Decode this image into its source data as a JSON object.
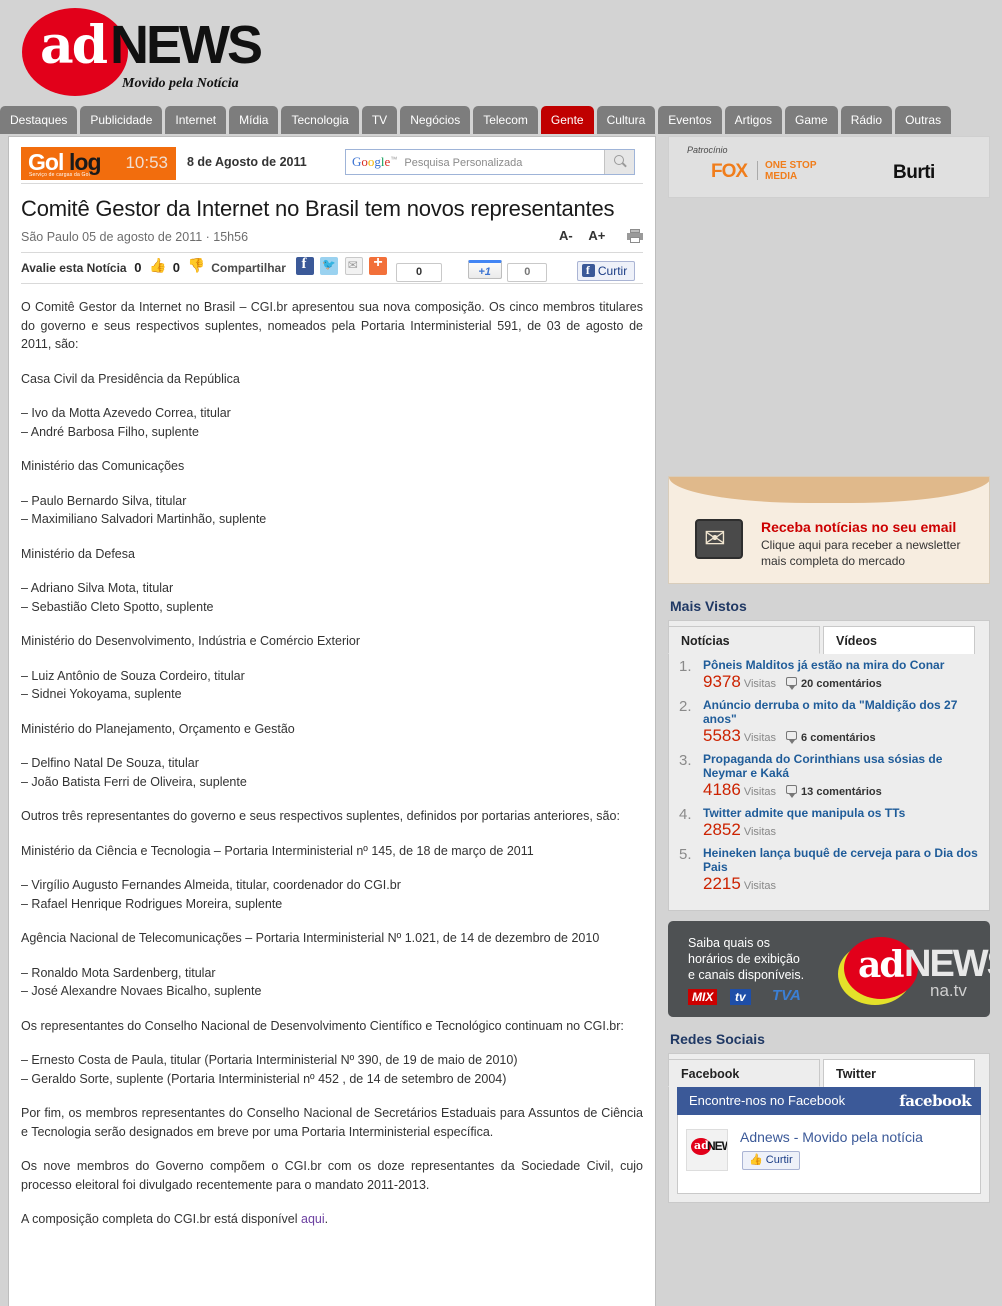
{
  "site": {
    "logo_ad": "ad",
    "logo_news": "NEWS",
    "tagline": "Movido pela Notícia"
  },
  "nav": {
    "items": [
      {
        "label": "Destaques",
        "active": false
      },
      {
        "label": "Publicidade",
        "active": false
      },
      {
        "label": "Internet",
        "active": false
      },
      {
        "label": "Mídia",
        "active": false
      },
      {
        "label": "Tecnologia",
        "active": false
      },
      {
        "label": "TV",
        "active": false
      },
      {
        "label": "Negócios",
        "active": false
      },
      {
        "label": "Telecom",
        "active": false
      },
      {
        "label": "Gente",
        "active": true
      },
      {
        "label": "Cultura",
        "active": false
      },
      {
        "label": "Eventos",
        "active": false
      },
      {
        "label": "Artigos",
        "active": false
      },
      {
        "label": "Game",
        "active": false
      },
      {
        "label": "Rádio",
        "active": false
      },
      {
        "label": "Outras",
        "active": false
      }
    ]
  },
  "topbar": {
    "gollog_go": "Gol",
    "gollog_log": "log",
    "gollog_sub": "Serviço de cargas da Gol",
    "time": "10:53",
    "date": "8 de Agosto de 2011",
    "search_brand": "Google",
    "search_tm": "™",
    "search_placeholder": "Pesquisa Personalizada"
  },
  "article": {
    "title": "Comitê Gestor da Internet no Brasil tem novos representantes",
    "byline": "São Paulo 05 de agosto de 2011 · 15h56",
    "font_decrease": "A-",
    "font_increase": "A+",
    "rate_label": "Avalie esta Notícia",
    "rate_up": "0",
    "rate_down": "0",
    "share_label": "Compartilhar",
    "share_count": "0",
    "plusone_label": "+1",
    "plusone_count": "0",
    "like_label": "Curtir",
    "paragraphs": [
      "O Comitê Gestor da Internet no Brasil – CGI.br apresentou sua nova composição. Os cinco membros titulares do governo e seus respectivos suplentes, nomeados pela Portaria Interministerial 591, de 03 de agosto de 2011, são:",
      "Casa Civil da Presidência da República",
      "– Ivo da Motta Azevedo Correa, titular\n– André Barbosa Filho, suplente",
      "Ministério das Comunicações",
      "– Paulo Bernardo Silva, titular\n– Maximiliano Salvadori Martinhão, suplente",
      "Ministério da Defesa",
      "– Adriano Silva Mota, titular\n– Sebastião Cleto Spotto, suplente",
      "Ministério do Desenvolvimento, Indústria e Comércio Exterior",
      "– Luiz Antônio de Souza Cordeiro, titular\n– Sidnei Yokoyama, suplente",
      "Ministério do Planejamento, Orçamento e Gestão",
      "– Delfino Natal De Souza, titular\n– João Batista Ferri de Oliveira, suplente",
      "Outros três representantes do governo e seus respectivos suplentes, definidos por portarias anteriores, são:",
      "Ministério da Ciência e Tecnologia – Portaria Interministerial nº 145, de 18 de março de 2011",
      "– Virgílio Augusto Fernandes Almeida, titular, coordenador do CGI.br\n– Rafael Henrique Rodrigues Moreira, suplente",
      "Agência Nacional de Telecomunicações – Portaria Interministerial Nº 1.021, de 14 de dezembro de 2010",
      "– Ronaldo Mota Sardenberg, titular\n– José Alexandre Novaes Bicalho, suplente",
      "Os representantes do Conselho Nacional de Desenvolvimento Científico e Tecnológico continuam no CGI.br:",
      "– Ernesto Costa de Paula, titular (Portaria Interministerial Nº 390, de 19 de maio de 2010)\n– Geraldo Sorte, suplente (Portaria Interministerial nº 452 , de 14 de setembro de 2004)",
      "Por fim, os membros representantes do Conselho Nacional de Secretários Estaduais para Assuntos de Ciência e Tecnologia serão designados em breve por uma Portaria Interministerial específica.",
      "Os nove membros do Governo compõem o CGI.br com os doze representantes da Sociedade Civil, cujo processo eleitoral foi divulgado recentemente para o mandato 2011-2013."
    ],
    "last_paragraph_prefix": "A composição completa do CGI.br está disponível ",
    "last_paragraph_link": "aqui",
    "last_paragraph_suffix": "."
  },
  "sidebar": {
    "sponsor": {
      "label": "Patrocínio",
      "fox": "FOX",
      "one_stop": "ONE STOP",
      "media": "MEDIA",
      "burti": "Burti"
    },
    "newsletter": {
      "headline": "Receba notícias no seu email",
      "sub_line1": "Clique aqui para receber a newsletter",
      "sub_line2": "mais completa do mercado"
    },
    "most_viewed": {
      "title": "Mais Vistos",
      "tab_news": "Notícias",
      "tab_videos": "Vídeos",
      "visits_label": "Visitas",
      "items": [
        {
          "rank": "1.",
          "title": "Pôneis Malditos já estão na mira do Conar",
          "visits": "9378",
          "comments": "20 comentários"
        },
        {
          "rank": "2.",
          "title": "Anúncio derruba o mito da \"Maldição dos 27 anos\"",
          "visits": "5583",
          "comments": "6 comentários"
        },
        {
          "rank": "3.",
          "title": "Propaganda do Corinthians usa sósias de Neymar e Kaká",
          "visits": "4186",
          "comments": "13 comentários"
        },
        {
          "rank": "4.",
          "title": "Twitter admite que manipula os TTs",
          "visits": "2852",
          "comments": ""
        },
        {
          "rank": "5.",
          "title": "Heineken lança buquê de cerveja para o Dia dos Pais",
          "visits": "2215",
          "comments": ""
        }
      ]
    },
    "adnews_tv": {
      "line1": "Saiba quais os",
      "line2": "horários de exibição",
      "line3": "e canais disponíveis.",
      "mix": "MIX",
      "tv": "tv",
      "tva": "TVA",
      "logo_ad": "ad",
      "logo_news": "NEWS",
      "na_tv": "na.tv"
    },
    "social": {
      "title": "Redes Sociais",
      "tab_facebook": "Facebook",
      "tab_twitter": "Twitter",
      "widget_header": "Encontre-nos no Facebook",
      "brand": "facebook",
      "page_name": "Adnews - Movido pela notícia",
      "like_label": "Curtir",
      "thumb_ad": "ad",
      "thumb_news": "NEWS"
    }
  },
  "colors": {
    "accent_red": "#c00000",
    "nav_gray": "#7d7d7d",
    "gollog_orange": "#f26d0d",
    "facebook_blue": "#3b5998",
    "visits_red": "#cc2200",
    "link_blue": "#1f5c99",
    "section_title": "#1f3864"
  }
}
